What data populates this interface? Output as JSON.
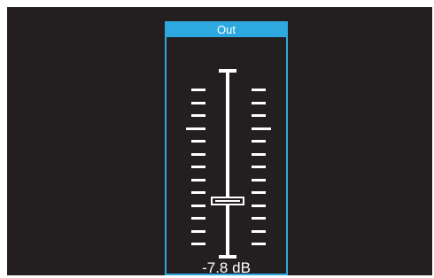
{
  "colors": {
    "background": "#231f20",
    "accent": "#2da9df",
    "foreground": "#ffffff"
  },
  "panel": {
    "title": "Out",
    "value_text": "-7.8 dB",
    "fader_level": 0.3
  }
}
